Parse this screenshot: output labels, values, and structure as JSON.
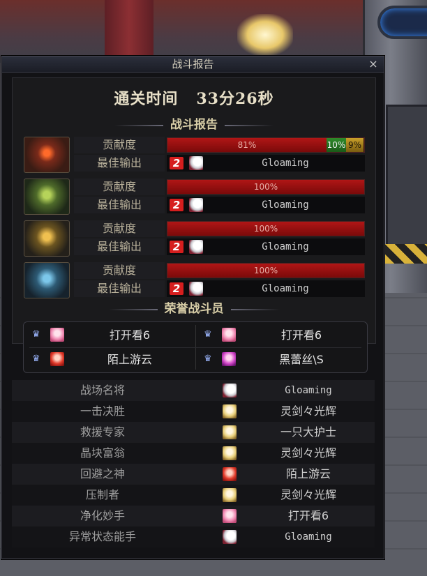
{
  "window": {
    "title": "战斗报告",
    "close_symbol": "×"
  },
  "clear_time": {
    "label": "通关时间",
    "value": "33分26秒"
  },
  "battle_report": {
    "heading": "战斗报告",
    "contribution_label": "贡献度",
    "best_output_label": "最佳输出",
    "rows": [
      {
        "boss_icon": "red-flame-boss-icon",
        "bar": [
          {
            "percent_label": "81%",
            "value": 81,
            "color": "#b01616"
          },
          {
            "percent_label": "10%",
            "value": 10,
            "color": "#2f8a2a"
          },
          {
            "percent_label": "9%",
            "value": 9,
            "color": "#caa02a"
          }
        ],
        "best_output": {
          "rank_badge": "2",
          "avatar": "white-hair-avatar",
          "name": "Gloaming"
        }
      },
      {
        "boss_icon": "green-boss-icon",
        "bar": [
          {
            "percent_label": "100%",
            "value": 100,
            "color": "#b01616"
          }
        ],
        "best_output": {
          "rank_badge": "2",
          "avatar": "white-hair-avatar",
          "name": "Gloaming"
        }
      },
      {
        "boss_icon": "gold-boss-icon",
        "bar": [
          {
            "percent_label": "100%",
            "value": 100,
            "color": "#b01616"
          }
        ],
        "best_output": {
          "rank_badge": "2",
          "avatar": "white-hair-avatar",
          "name": "Gloaming"
        }
      },
      {
        "boss_icon": "blue-boss-icon",
        "bar": [
          {
            "percent_label": "100%",
            "value": 100,
            "color": "#b01616"
          }
        ],
        "best_output": {
          "rank_badge": "2",
          "avatar": "white-hair-avatar",
          "name": "Gloaming"
        }
      }
    ]
  },
  "honor": {
    "heading": "荣誉战斗员",
    "members": [
      {
        "medal": "medal-icon",
        "avatar": "pink-hair-avatar",
        "name": "打开看6"
      },
      {
        "medal": "medal-icon",
        "avatar": "pink-hair-avatar",
        "name": "打开看6"
      },
      {
        "medal": "medal-icon",
        "avatar": "red-hair-avatar",
        "name": "陌上游云"
      },
      {
        "medal": "medal-icon",
        "avatar": "magenta-hair-avatar",
        "name": "黑蕾丝\\S"
      }
    ]
  },
  "awards": [
    {
      "title": "战场名将",
      "avatar": "white-hair-avatar",
      "player": "Gloaming"
    },
    {
      "title": "一击决胜",
      "avatar": "blonde-avatar",
      "player": "灵剑々光辉"
    },
    {
      "title": "救援专家",
      "avatar": "blonde-avatar",
      "player": "一只大护士"
    },
    {
      "title": "晶块富翁",
      "avatar": "blonde-avatar",
      "player": "灵剑々光辉"
    },
    {
      "title": "回避之神",
      "avatar": "red-hair-avatar",
      "player": "陌上游云"
    },
    {
      "title": "压制者",
      "avatar": "blonde-avatar",
      "player": "灵剑々光辉"
    },
    {
      "title": "净化妙手",
      "avatar": "pink-hair-avatar",
      "player": "打开看6"
    },
    {
      "title": "异常状态能手",
      "avatar": "white-hair-avatar",
      "player": "Gloaming"
    }
  ]
}
